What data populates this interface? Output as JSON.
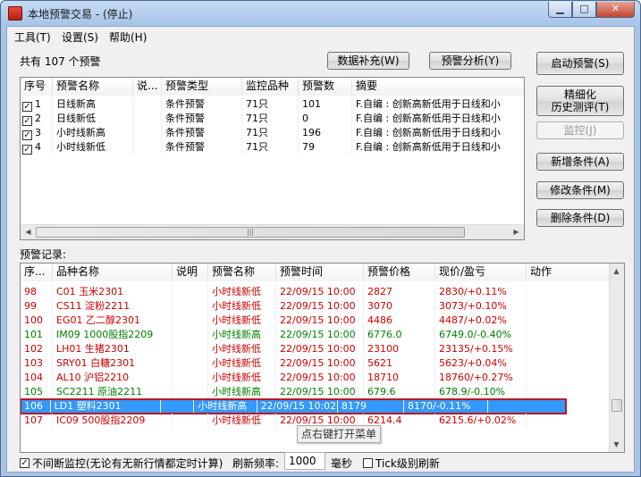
{
  "window": {
    "title": "本地预警交易 - (停止)",
    "min_label": "▁",
    "max_label": "□",
    "close_label": "✕"
  },
  "menu": [
    {
      "label": "工具(T)"
    },
    {
      "label": "设置(S)"
    },
    {
      "label": "帮助(H)"
    }
  ],
  "summary": "共有 107 个预警",
  "top_buttons": {
    "data_supplement": "数据补充(W)",
    "alert_analysis": "预警分析(Y)"
  },
  "side_buttons": {
    "start_alert": "启动预警(S)",
    "refine_line1": "精细化",
    "refine_line2": "历史测评(T)",
    "monitor": "监控(J)",
    "add_condition": "新增条件(A)",
    "modify_condition": "修改条件(M)",
    "delete_condition": "删除条件(D)"
  },
  "conditions": {
    "headers": [
      "序号",
      "预警名称",
      "说...",
      "预警类型",
      "监控品种",
      "预警数",
      "摘要"
    ],
    "rows": [
      {
        "checked": true,
        "index": "1",
        "name": "日线新高",
        "desc": "",
        "type": "条件预警",
        "target": "71只",
        "count": "101",
        "summary": "F.自编 : 创新高新低用于日线和小"
      },
      {
        "checked": true,
        "index": "2",
        "name": "日线新低",
        "desc": "",
        "type": "条件预警",
        "target": "71只",
        "count": "0",
        "summary": "F.自编 : 创新高新低用于日线和小"
      },
      {
        "checked": true,
        "index": "3",
        "name": "小时线新高",
        "desc": "",
        "type": "条件预警",
        "target": "71只",
        "count": "196",
        "summary": "F.自编 : 创新高新低用于日线和小"
      },
      {
        "checked": true,
        "index": "4",
        "name": "小时线新低",
        "desc": "",
        "type": "条件预警",
        "target": "71只",
        "count": "79",
        "summary": "F.自编 : 创新高新低用于日线和小"
      }
    ],
    "hscroll_grip": "|||"
  },
  "records_label": "预警记录:",
  "records": {
    "headers": [
      "序...",
      "品种名称",
      "说明",
      "预警名称",
      "预警时间",
      "预警价格",
      "现价/盈亏",
      "动作"
    ],
    "rows": [
      {
        "seq": "98",
        "code": "C01",
        "name": "玉米2301",
        "note": "",
        "alert": "小时线新低",
        "time": "22/09/15 10:00",
        "price": "2827",
        "pnl": "2830/+0.11%",
        "action": "",
        "color": "#cc0000"
      },
      {
        "seq": "99",
        "code": "CS11",
        "name": "淀粉2211",
        "note": "",
        "alert": "小时线新低",
        "time": "22/09/15 10:00",
        "price": "3070",
        "pnl": "3073/+0.10%",
        "action": "",
        "color": "#cc0000"
      },
      {
        "seq": "100",
        "code": "EG01",
        "name": "乙二醇2301",
        "note": "",
        "alert": "小时线新低",
        "time": "22/09/15 10:00",
        "price": "4486",
        "pnl": "4487/+0.02%",
        "action": "",
        "color": "#cc0000"
      },
      {
        "seq": "101",
        "code": "IM09",
        "name": "1000股指2209",
        "note": "",
        "alert": "小时线新高",
        "time": "22/09/15 10:00",
        "price": "6776.0",
        "pnl": "6749.0/-0.40%",
        "action": "",
        "color": "#008000"
      },
      {
        "seq": "102",
        "code": "LH01",
        "name": "生猪2301",
        "note": "",
        "alert": "小时线新低",
        "time": "22/09/15 10:00",
        "price": "23100",
        "pnl": "23135/+0.15%",
        "action": "",
        "color": "#cc0000"
      },
      {
        "seq": "103",
        "code": "SRY01",
        "name": "白糖2301",
        "note": "",
        "alert": "小时线新低",
        "time": "22/09/15 10:00",
        "price": "5621",
        "pnl": "5623/+0.04%",
        "action": "",
        "color": "#cc0000"
      },
      {
        "seq": "104",
        "code": "AL10",
        "name": "沪铝2210",
        "note": "",
        "alert": "小时线新低",
        "time": "22/09/15 10:00",
        "price": "18710",
        "pnl": "18760/+0.27%",
        "action": "",
        "color": "#cc0000"
      },
      {
        "seq": "105",
        "code": "SC2211",
        "name": "原油2211",
        "note": "",
        "alert": "小时线新高",
        "time": "22/09/15 10:00",
        "price": "679.6",
        "pnl": "678.9/-0.10%",
        "action": "",
        "color": "#008000"
      },
      {
        "seq": "106",
        "code": "LD1",
        "name": "塑料2301",
        "note": "",
        "alert": "小时线新高",
        "time": "22/09/15 10:02",
        "price": "8179",
        "pnl": "8170/-0.11%",
        "action": "",
        "color": "#ffffff",
        "selected": true
      },
      {
        "seq": "107",
        "code": "IC09",
        "name": "500股指2209",
        "note": "",
        "alert": "小时线新低",
        "time": "22/09/15 10:00",
        "price": "6214.4",
        "pnl": "6215.6/+0.02%",
        "action": "",
        "color": "#cc0000"
      }
    ]
  },
  "tooltip": "点右键打开菜单",
  "footer": {
    "continuous_monitor": "不间断监控(无论有无新行情都定时计算)",
    "continuous_checked": true,
    "refresh_label": "刷新频率:",
    "refresh_value": "1000",
    "unit": "毫秒",
    "tick_refresh": "Tick级别刷新",
    "tick_checked": false
  },
  "colors": {
    "selected_row_bg": "#3399ff",
    "selection_outline": "#c0141e",
    "down_color": "#cc0000",
    "up_color": "#008000"
  }
}
